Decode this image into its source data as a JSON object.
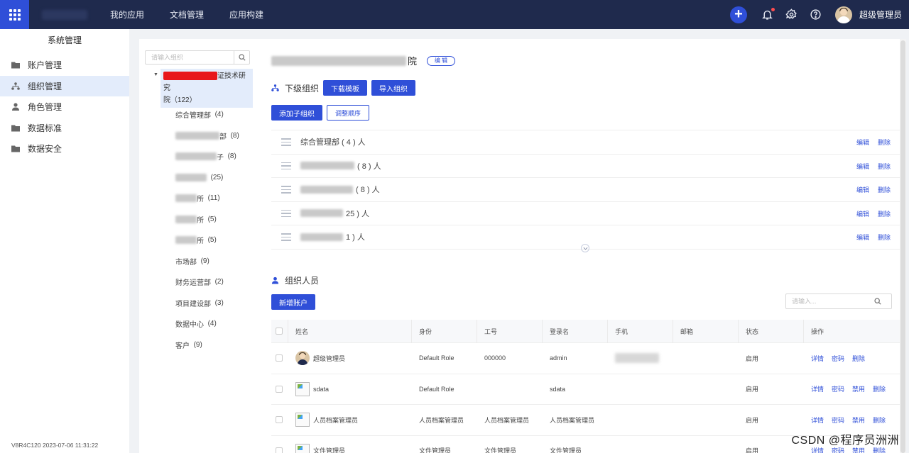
{
  "topbar": {
    "nav": [
      "我的应用",
      "文档管理",
      "应用构建"
    ],
    "user_name": "超级管理员",
    "icons": [
      "apps-grid-icon",
      "plus-icon",
      "bell-icon",
      "gear-icon",
      "help-icon"
    ],
    "brand_color": "#2f4fd8",
    "bar_color": "#1f2a4d"
  },
  "sidebar": {
    "title": "系统管理",
    "items": [
      {
        "label": "账户管理",
        "icon": "folder-icon",
        "active": false
      },
      {
        "label": "组织管理",
        "icon": "org-tree-icon",
        "active": true
      },
      {
        "label": "角色管理",
        "icon": "user-icon",
        "active": false
      },
      {
        "label": "数据标准",
        "icon": "folder-icon",
        "active": false
      },
      {
        "label": "数据安全",
        "icon": "folder-icon",
        "active": false
      }
    ],
    "version": "V8R4C120 2023-07-06 11:31:22"
  },
  "tree": {
    "search_placeholder": "请输入组织",
    "root_label_visible": "证技术研究",
    "root_label_line2": "院（122）",
    "children": [
      {
        "label": "综合管理部",
        "count": "(4)",
        "blurred": false
      },
      {
        "label": "部",
        "count": "(8)",
        "blurred": true
      },
      {
        "label": "子",
        "count": "(8)",
        "blurred": true
      },
      {
        "label": "",
        "count": "(25)",
        "blurred": true
      },
      {
        "label": "所",
        "count": "(11)",
        "blurred": true
      },
      {
        "label": "所",
        "count": "(5)",
        "blurred": true
      },
      {
        "label": "所",
        "count": "(5)",
        "blurred": true
      },
      {
        "label": "市场部",
        "count": "(9)",
        "blurred": false
      },
      {
        "label": "财务运营部",
        "count": "(2)",
        "blurred": false
      },
      {
        "label": "项目建设部",
        "count": "(3)",
        "blurred": false
      },
      {
        "label": "数据中心",
        "count": "(4)",
        "blurred": false
      },
      {
        "label": "客户",
        "count": "(9)",
        "blurred": false
      }
    ]
  },
  "main": {
    "org_title_suffix": "院",
    "edit_label": "编 辑",
    "sub_orgs_title": "下级组织",
    "download_template": "下载模板",
    "import_org": "导入组织",
    "add_child": "添加子组织",
    "adjust_order": "调整顺序",
    "sub_orgs": [
      {
        "name": "综合管理部 ( 4 ) 人",
        "blurred": false
      },
      {
        "name": "( 8 ) 人",
        "blurred": true
      },
      {
        "name": "( 8 ) 人",
        "blurred": true
      },
      {
        "name": "25 ) 人",
        "blurred": true
      },
      {
        "name": "1 ) 人",
        "blurred": true
      }
    ],
    "row_edit": "编辑",
    "row_delete": "删除",
    "people_title": "组织人员",
    "add_account": "新增账户",
    "people_search_placeholder": "请输入..."
  },
  "table": {
    "headers": [
      "姓名",
      "身份",
      "工号",
      "登录名",
      "手机",
      "邮箱",
      "状态",
      "操作"
    ],
    "rows": [
      {
        "name": "超级管理员",
        "avatar": "avatar",
        "role": "Default Role",
        "id": "000000",
        "login": "admin",
        "status": "启用",
        "ops": [
          "详情",
          "密码",
          "删除"
        ]
      },
      {
        "name": "sdata",
        "avatar": "broken",
        "role": "Default Role",
        "id": "",
        "login": "sdata",
        "status": "启用",
        "ops": [
          "详情",
          "密码",
          "禁用",
          "删除"
        ]
      },
      {
        "name": "人员档案管理员",
        "avatar": "broken",
        "role": "人员档案管理员",
        "id": "人员档案管理员",
        "login": "人员档案管理员",
        "status": "启用",
        "ops": [
          "详情",
          "密码",
          "禁用",
          "删除"
        ]
      },
      {
        "name": "文件管理员",
        "avatar": "broken",
        "role": "文件管理员",
        "id": "文件管理员",
        "login": "文件管理员",
        "status": "启用",
        "ops": [
          "详情",
          "密码",
          "禁用",
          "删除"
        ]
      }
    ]
  },
  "watermark": "CSDN @程序员洲洲"
}
